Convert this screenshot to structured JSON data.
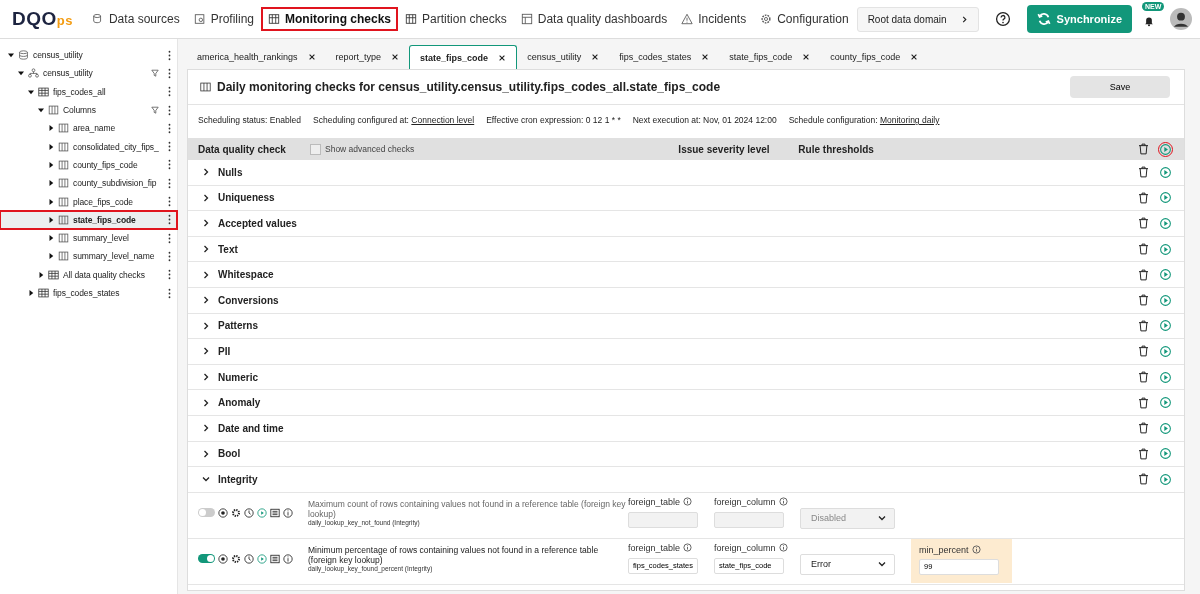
{
  "topbar": {
    "logo": {
      "main": "DQO",
      "suffix": "ps"
    },
    "nav": [
      {
        "label": "Data sources",
        "kind": "sources",
        "highlighted": false
      },
      {
        "label": "Profiling",
        "kind": "profiling",
        "highlighted": false
      },
      {
        "label": "Monitoring checks",
        "kind": "monitoring",
        "highlighted": true
      },
      {
        "label": "Partition checks",
        "kind": "partition",
        "highlighted": false
      },
      {
        "label": "Data quality dashboards",
        "kind": "dashboards",
        "highlighted": false
      },
      {
        "label": "Incidents",
        "kind": "incidents",
        "highlighted": false
      },
      {
        "label": "Configuration",
        "kind": "configuration",
        "highlighted": false
      }
    ],
    "domain": "Root data domain",
    "sync": "Synchronize",
    "badge": "NEW"
  },
  "tree": [
    {
      "label": "census_utility",
      "kind": "database",
      "expanded": true,
      "selected": false,
      "highlighted": false,
      "children": [
        {
          "label": "census_utility",
          "kind": "schema",
          "expanded": true,
          "selected": false,
          "highlighted": false,
          "filter": true,
          "children": [
            {
              "label": "fips_codes_all",
              "kind": "table",
              "expanded": true,
              "selected": false,
              "highlighted": false,
              "children": [
                {
                  "label": "Columns",
                  "kind": "columns",
                  "expanded": true,
                  "selected": false,
                  "highlighted": false,
                  "filter": true,
                  "children": [
                    {
                      "label": "area_name",
                      "kind": "column",
                      "expanded": false,
                      "selected": false,
                      "highlighted": false
                    },
                    {
                      "label": "consolidated_city_fips_",
                      "kind": "column",
                      "expanded": false,
                      "selected": false,
                      "highlighted": false
                    },
                    {
                      "label": "county_fips_code",
                      "kind": "column",
                      "expanded": false,
                      "selected": false,
                      "highlighted": false
                    },
                    {
                      "label": "county_subdivision_fip",
                      "kind": "column",
                      "expanded": false,
                      "selected": false,
                      "highlighted": false
                    },
                    {
                      "label": "place_fips_code",
                      "kind": "column",
                      "expanded": false,
                      "selected": false,
                      "highlighted": false
                    },
                    {
                      "label": "state_fips_code",
                      "kind": "column",
                      "expanded": false,
                      "selected": true,
                      "highlighted": true
                    },
                    {
                      "label": "summary_level",
                      "kind": "column",
                      "expanded": false,
                      "selected": false,
                      "highlighted": false
                    },
                    {
                      "label": "summary_level_name",
                      "kind": "column",
                      "expanded": false,
                      "selected": false,
                      "highlighted": false
                    }
                  ]
                },
                {
                  "label": "All data quality checks",
                  "kind": "checks",
                  "expanded": false,
                  "selected": false,
                  "highlighted": false
                }
              ]
            },
            {
              "label": "fips_codes_states",
              "kind": "table",
              "expanded": false,
              "selected": false,
              "highlighted": false
            }
          ]
        }
      ]
    }
  ],
  "tabs": [
    {
      "label": "america_health_rankings",
      "selected": false
    },
    {
      "label": "report_type",
      "selected": false
    },
    {
      "label": "state_fips_code",
      "selected": true
    },
    {
      "label": "census_utility",
      "selected": false
    },
    {
      "label": "fips_codes_states",
      "selected": false
    },
    {
      "label": "state_fips_code",
      "selected": false
    },
    {
      "label": "county_fips_code",
      "selected": false
    }
  ],
  "header": {
    "title": "Daily monitoring checks for census_utility.census_utility.fips_codes_all.state_fips_code",
    "save": "Save"
  },
  "schedule": [
    {
      "label": "Scheduling status: Enabled"
    },
    {
      "label": "Scheduling configured at:",
      "link": "Connection level"
    },
    {
      "label": "Effective cron expression: 0 12 1 * *"
    },
    {
      "label": "Next execution at: Nov, 01 2024 12:00"
    },
    {
      "label": "Schedule configuration:",
      "link": "Monitoring daily"
    }
  ],
  "table_header": {
    "check": "Data quality check",
    "advanced": {
      "label": "Show advanced checks",
      "checked": false
    },
    "severity": "Issue severity level",
    "thresholds": "Rule thresholds",
    "run_highlighted": true
  },
  "categories": [
    {
      "name": "Nulls",
      "expanded": false
    },
    {
      "name": "Uniqueness",
      "expanded": false
    },
    {
      "name": "Accepted values",
      "expanded": false
    },
    {
      "name": "Text",
      "expanded": false
    },
    {
      "name": "Whitespace",
      "expanded": false
    },
    {
      "name": "Conversions",
      "expanded": false
    },
    {
      "name": "Patterns",
      "expanded": false
    },
    {
      "name": "PII",
      "expanded": false
    },
    {
      "name": "Numeric",
      "expanded": false
    },
    {
      "name": "Anomaly",
      "expanded": false
    },
    {
      "name": "Date and time",
      "expanded": false
    },
    {
      "name": "Bool",
      "expanded": false
    },
    {
      "name": "Integrity",
      "expanded": true
    }
  ],
  "checks": [
    {
      "enabled": false,
      "description": "Maximum count of rows containing values not found in a reference table (foreign key lookup)",
      "name": "daily_lookup_key_not_found (Integrity)",
      "params": [
        {
          "label": "foreign_table"
        },
        {
          "label": "foreign_column"
        }
      ],
      "severity": "Disabled"
    },
    {
      "enabled": true,
      "description": "Minimum percentage of rows containing values not found in a reference table (foreign key lookup)",
      "name": "daily_lookup_key_found_percent (Integrity)",
      "params": [
        {
          "label": "foreign_table",
          "value": "fips_codes_states"
        },
        {
          "label": "foreign_column",
          "value": "state_fips_code"
        }
      ],
      "severity": "Error",
      "threshold": {
        "label": "min_percent",
        "value": "99"
      }
    }
  ]
}
